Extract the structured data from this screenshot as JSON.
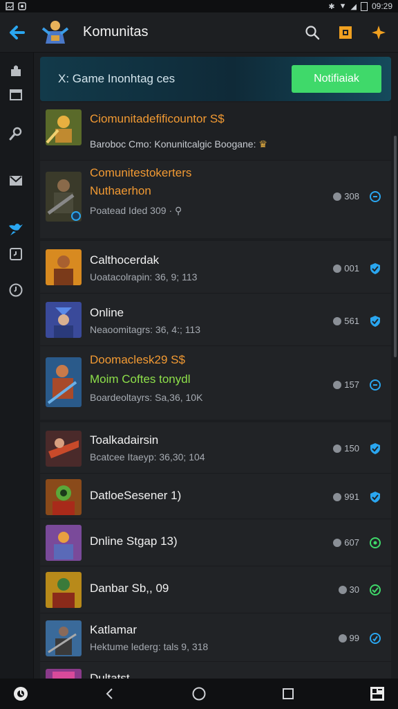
{
  "status_bar": {
    "time": "09:29",
    "icons": [
      "image-icon",
      "sync-icon",
      "bluetooth-icon",
      "wifi-icon",
      "signal-icon",
      "battery-icon"
    ]
  },
  "app_bar": {
    "title": "Komunitas",
    "back_icon": "arrow-left-icon",
    "search_icon": "search-icon",
    "badge_icon": "square-badge-icon",
    "star_icon": "star-icon"
  },
  "sidebar": {
    "items": [
      "puzzle-icon",
      "inbox-icon",
      "search-key-icon",
      "mail-icon",
      "bird-icon",
      "clock-box-icon",
      "clock-icon"
    ]
  },
  "banner": {
    "text": "X: Game Inonhtag ces",
    "button": "Notifiaiak"
  },
  "colors": {
    "accent_blue": "#2aa6f0",
    "accent_green": "#3fd96a",
    "accent_orange": "#f29a33",
    "light_green": "#8ee04a"
  },
  "rows": [
    {
      "title": "Ciomunitadefificountor S$",
      "sub": "Baroboc Cmo: Konunitcalgic Boogane:",
      "count": "",
      "status": ""
    },
    {
      "title": "Comunitestokerters",
      "title2": "Nuthaerhon",
      "sub": "Poatead Ided 309",
      "count": "308",
      "status": "circle"
    },
    {
      "title": "Calthocerdak",
      "sub": "Uoatacolrapin: 36, 9; 113",
      "count": "001",
      "status": "shield"
    },
    {
      "title": "Online",
      "sub": "Neaoomitagrs: 36, 4:; 113",
      "count": "561",
      "status": "shield"
    },
    {
      "title": "Doomaclesk29 S$",
      "title2": "Moim Coftes tonydl",
      "sub": "Boardeoltayrs: Sa,36, 10K",
      "count": "157",
      "status": "circle"
    },
    {
      "title": "Toalkadairsin",
      "sub": "Bcatcee Itaeyp: 36,30; 104",
      "count": "150",
      "status": "shield"
    },
    {
      "title": "DatloeSesener 1)",
      "sub": "",
      "count": "991",
      "status": "shield"
    },
    {
      "title": "Dnline Stgap 13)",
      "sub": "",
      "count": "607",
      "status": "circle-green"
    },
    {
      "title": "Danbar Sb,, 09",
      "sub": "",
      "count": "30",
      "status": "check-green"
    },
    {
      "title": "Katlamar",
      "sub": "Hektume lederg: tals 9, 318",
      "count": "99",
      "status": "circle"
    },
    {
      "title": "Dultatst",
      "sub": "",
      "count": "",
      "status": ""
    }
  ],
  "nav_bar": {
    "icons": [
      "app-circle-icon",
      "back-nav-icon",
      "home-nav-icon",
      "recents-nav-icon",
      "gallery-icon"
    ]
  }
}
